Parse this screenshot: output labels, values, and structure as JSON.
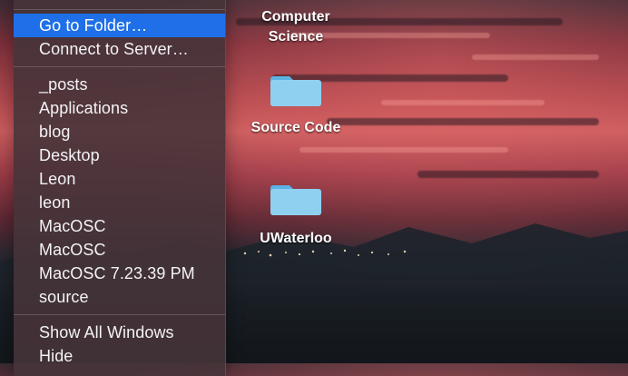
{
  "menu": {
    "top_items": [
      {
        "label": "Go to Folder…",
        "highlighted": true
      },
      {
        "label": "Connect to Server…",
        "highlighted": false
      }
    ],
    "recent_folders": [
      {
        "label": "_posts"
      },
      {
        "label": "Applications"
      },
      {
        "label": "blog"
      },
      {
        "label": "Desktop"
      },
      {
        "label": "Leon"
      },
      {
        "label": "leon"
      },
      {
        "label": "MacOSC"
      },
      {
        "label": "MacOSC"
      },
      {
        "label": "MacOSC 7.23.39 PM"
      },
      {
        "label": "source"
      }
    ],
    "bottom_items": [
      {
        "label": "Show All Windows"
      },
      {
        "label": "Hide"
      }
    ]
  },
  "desktop": {
    "items": [
      {
        "label_line1": "Computer",
        "label_line2": "Science",
        "icon": "folder-icon"
      },
      {
        "label": "Source Code",
        "icon": "folder-icon"
      },
      {
        "label": "UWaterloo",
        "icon": "folder-icon"
      }
    ]
  },
  "colors": {
    "highlight": "#1f6fe8",
    "folder_light": "#8fd0f1",
    "folder_dark": "#5bb2e3"
  }
}
